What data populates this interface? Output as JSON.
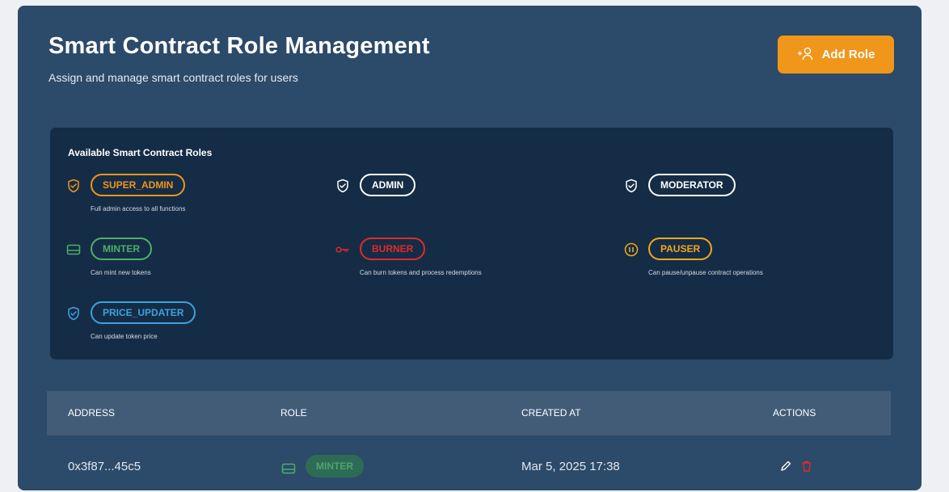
{
  "header": {
    "title": "Smart Contract Role Management",
    "subtitle": "Assign and manage smart contract roles for users",
    "add_role_label": "Add Role"
  },
  "roles_card": {
    "heading": "Available Smart Contract Roles",
    "roles": [
      {
        "name": "SUPER_ADMIN",
        "description": "Full admin access to all functions",
        "color": "#f0961a",
        "icon": "shield-check-icon"
      },
      {
        "name": "ADMIN",
        "description": "",
        "color": "#ffffff",
        "icon": "shield-check-icon"
      },
      {
        "name": "MODERATOR",
        "description": "",
        "color": "#ffffff",
        "icon": "shield-check-icon"
      },
      {
        "name": "MINTER",
        "description": "Can mint new tokens",
        "color": "#4caf6a",
        "icon": "card-icon"
      },
      {
        "name": "BURNER",
        "description": "Can burn tokens and process redemptions",
        "color": "#e02a2a",
        "icon": "key-icon"
      },
      {
        "name": "PAUSER",
        "description": "Can pause/unpause contract operations",
        "color": "#f0a81a",
        "icon": "pause-circle-icon"
      },
      {
        "name": "PRICE_UPDATER",
        "description": "Can update token price",
        "color": "#3ba3e0",
        "icon": "shield-check-icon"
      }
    ]
  },
  "table": {
    "columns": [
      "ADDRESS",
      "ROLE",
      "CREATED AT",
      "ACTIONS"
    ],
    "rows": [
      {
        "address": "0x3f87...45c5",
        "role": "MINTER",
        "created_at": "Mar 5, 2025 17:38"
      }
    ]
  },
  "colors": {
    "accent": "#f0961a",
    "panel_bg": "#2c4a69",
    "card_bg": "#152c46",
    "table_header_bg": "#425c78",
    "delete_icon": "#e02a2a"
  }
}
